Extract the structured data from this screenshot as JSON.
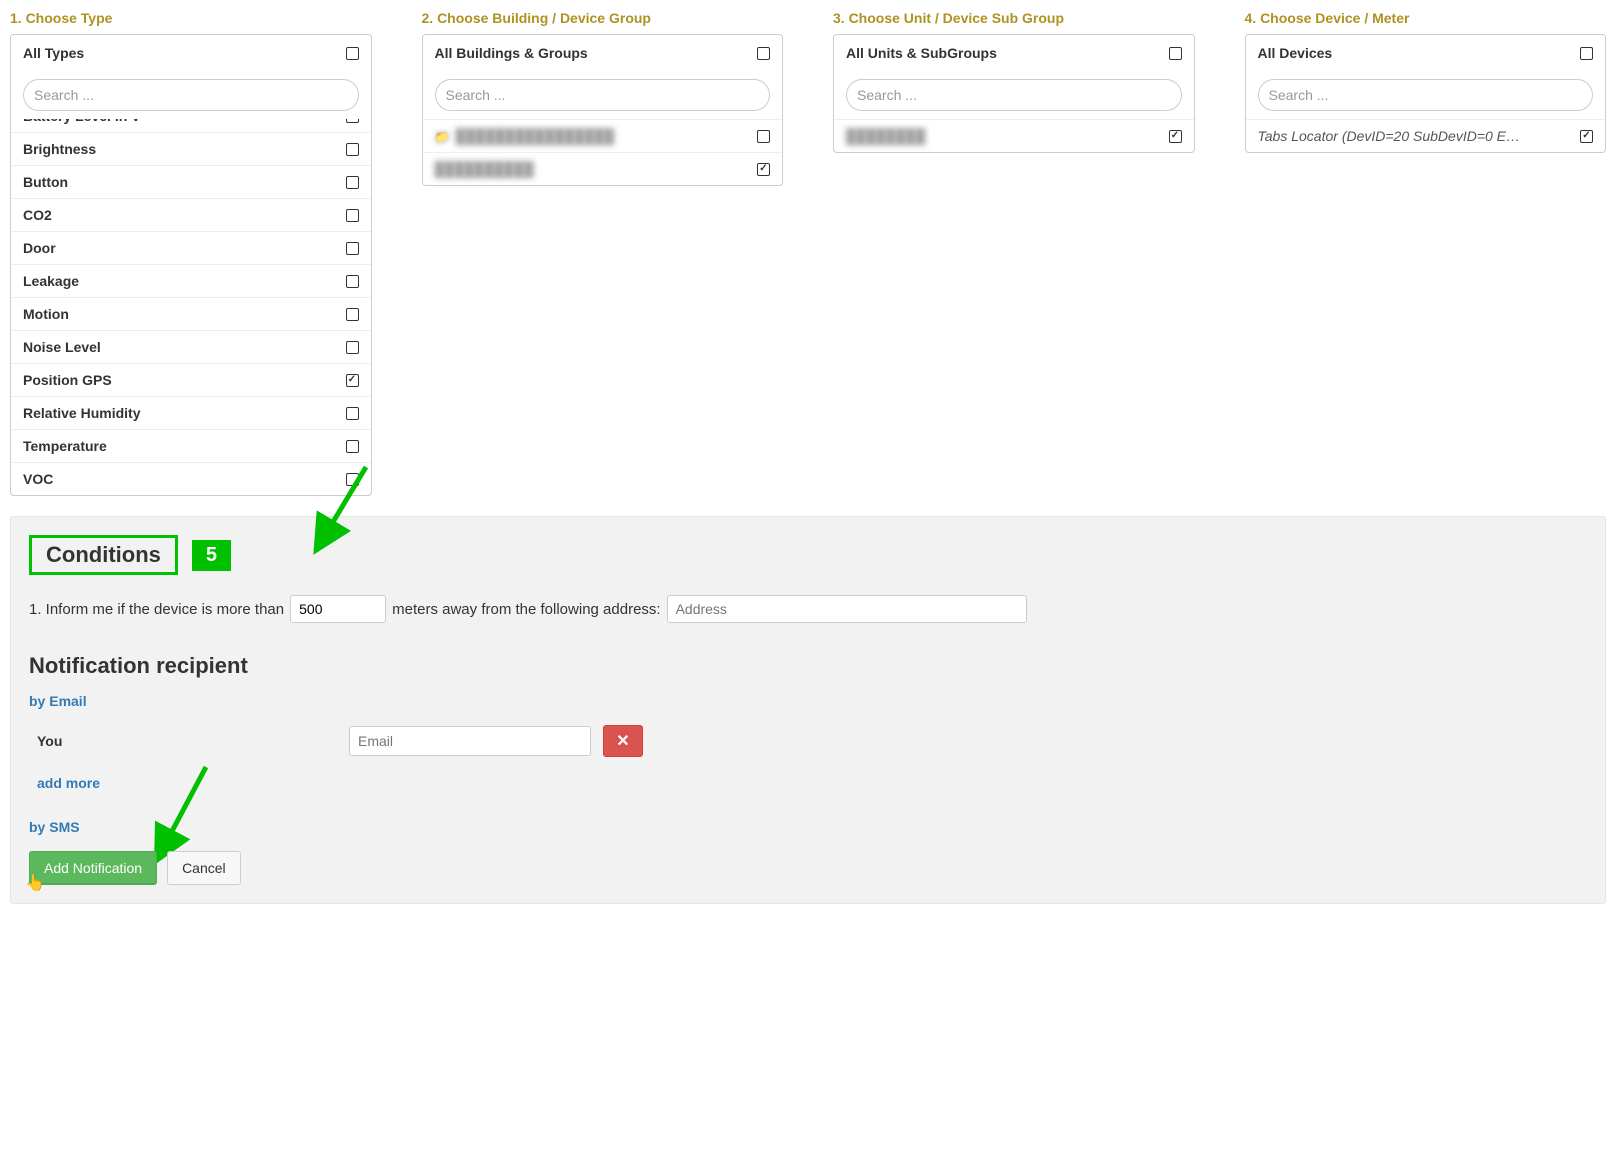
{
  "steps": {
    "type": {
      "title": "1. Choose Type",
      "header": "All Types",
      "search_ph": "Search ..."
    },
    "building": {
      "title": "2. Choose Building / Device Group",
      "header": "All Buildings & Groups",
      "search_ph": "Search ..."
    },
    "unit": {
      "title": "3. Choose Unit / Device Sub Group",
      "header": "All Units & SubGroups",
      "search_ph": "Search ..."
    },
    "device": {
      "title": "4. Choose Device / Meter",
      "header": "All Devices",
      "search_ph": "Search ..."
    }
  },
  "type_items": [
    {
      "label": "Battery Level in V",
      "checked": false
    },
    {
      "label": "Brightness",
      "checked": false
    },
    {
      "label": "Button",
      "checked": false
    },
    {
      "label": "CO2",
      "checked": false
    },
    {
      "label": "Door",
      "checked": false
    },
    {
      "label": "Leakage",
      "checked": false
    },
    {
      "label": "Motion",
      "checked": false
    },
    {
      "label": "Noise Level",
      "checked": false
    },
    {
      "label": "Position GPS",
      "checked": true
    },
    {
      "label": "Relative Humidity",
      "checked": false
    },
    {
      "label": "Temperature",
      "checked": false
    },
    {
      "label": "VOC",
      "checked": false
    }
  ],
  "building_items": [
    {
      "label": "████████████████",
      "checked": false,
      "folder": true
    },
    {
      "label": "██████████",
      "checked": true,
      "folder": false
    }
  ],
  "unit_items": [
    {
      "label": "████████",
      "checked": true
    }
  ],
  "device_items": [
    {
      "label": "Tabs Locator (DevID=20 SubDevID=0 E…",
      "checked": true
    }
  ],
  "conditions": {
    "title": "Conditions",
    "step_num": "5",
    "line_prefix": "1. Inform me if the device is more than",
    "distance_value": "500",
    "line_mid": "meters away from the following address:",
    "address_ph": "Address"
  },
  "recipient": {
    "title": "Notification recipient",
    "by_email": "by Email",
    "you": "You",
    "email_ph": "Email",
    "add_more": "add more",
    "by_sms": "by SMS"
  },
  "actions": {
    "add": "Add Notification",
    "cancel": "Cancel"
  }
}
